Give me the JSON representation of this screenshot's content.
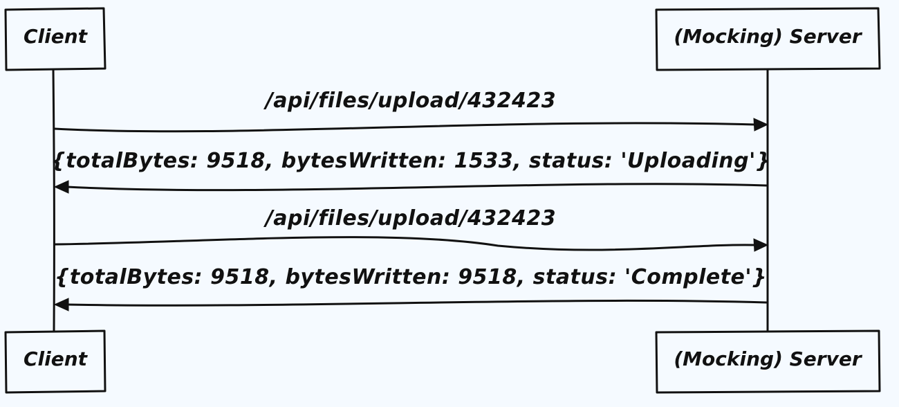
{
  "participants": [
    {
      "id": "client",
      "label": "Client"
    },
    {
      "id": "server",
      "label": "(Mocking) Server"
    }
  ],
  "messages": [
    {
      "from": "client",
      "to": "server",
      "label": "/api/files/upload/432423"
    },
    {
      "from": "server",
      "to": "client",
      "label": "{totalBytes: 9518, bytesWritten: 1533, status: 'Uploading'}"
    },
    {
      "from": "client",
      "to": "server",
      "label": "/api/files/upload/432423"
    },
    {
      "from": "server",
      "to": "client",
      "label": "{totalBytes: 9518, bytesWritten: 9518, status: 'Complete'}"
    }
  ],
  "colors": {
    "background": "#f5faff",
    "ink": "#111111"
  }
}
